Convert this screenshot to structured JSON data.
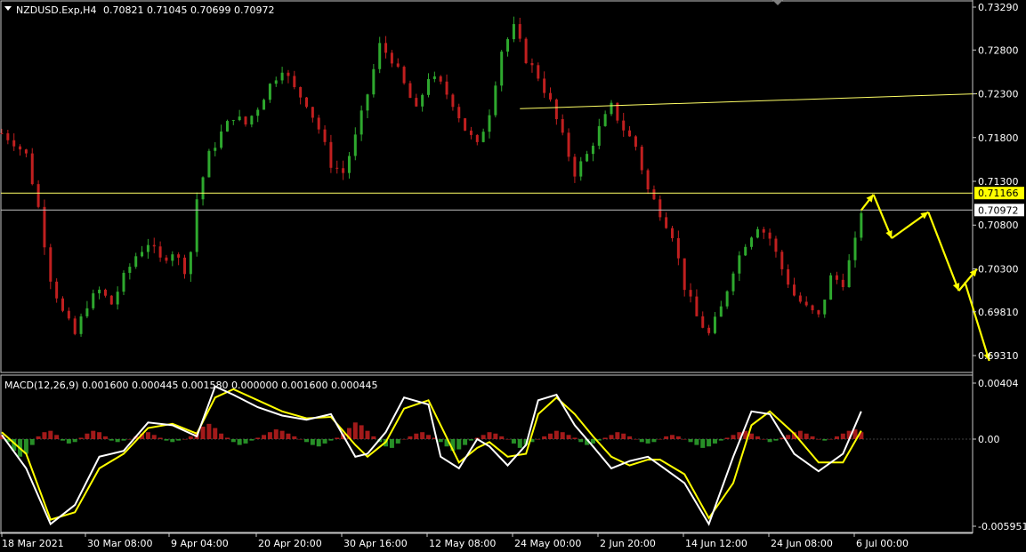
{
  "header": {
    "symbol_label": "NZDUSD.Exp,H4",
    "ohlc_label": "0.70821 0.71045 0.70699 0.70972"
  },
  "macd": {
    "label": "MACD(12,26,9) 0.001600 0.000445 0.001580 0.000000 0.001600 0.000445"
  },
  "colors": {
    "background": "#000000",
    "bull": "#2ea82e",
    "bear": "#c01f1f",
    "signal": "#ffff00",
    "macd_line": "#ffffff",
    "level": "#ffff66",
    "price_marker": "#c0c0c0"
  },
  "chart_data": [
    {
      "type": "candlestick",
      "symbol": "NZDUSD.Exp",
      "timeframe": "H4",
      "y_ticks": [
        "0.73290",
        "0.72800",
        "0.72300",
        "0.71800",
        "0.71300",
        "0.70800",
        "0.70300",
        "0.69810",
        "0.69310"
      ],
      "ylim": [
        0.692,
        0.734
      ],
      "x_ticks": [
        "18 Mar 2021",
        "30 Mar 08:00",
        "9 Apr 04:00",
        "20 Apr 20:00",
        "30 Apr 16:00",
        "12 May 08:00",
        "24 May 00:00",
        "2 Jun 20:00",
        "14 Jun 12:00",
        "24 Jun 08:00",
        "6 Jul 00:00"
      ],
      "close_path": [
        [
          0,
          0.7185
        ],
        [
          2,
          0.7175
        ],
        [
          4,
          0.716
        ],
        [
          6,
          0.71
        ],
        [
          8,
          0.702
        ],
        [
          10,
          0.698
        ],
        [
          12,
          0.6955
        ],
        [
          14,
          0.699
        ],
        [
          16,
          0.7005
        ],
        [
          18,
          0.699
        ],
        [
          20,
          0.702
        ],
        [
          22,
          0.7045
        ],
        [
          24,
          0.706
        ],
        [
          26,
          0.704
        ],
        [
          28,
          0.705
        ],
        [
          30,
          0.703
        ],
        [
          31,
          0.705
        ],
        [
          32,
          0.711
        ],
        [
          34,
          0.716
        ],
        [
          36,
          0.7185
        ],
        [
          38,
          0.7205
        ],
        [
          40,
          0.7195
        ],
        [
          42,
          0.7215
        ],
        [
          44,
          0.724
        ],
        [
          46,
          0.726
        ],
        [
          48,
          0.7235
        ],
        [
          50,
          0.722
        ],
        [
          52,
          0.719
        ],
        [
          54,
          0.715
        ],
        [
          56,
          0.714
        ],
        [
          58,
          0.718
        ],
        [
          60,
          0.723
        ],
        [
          62,
          0.7285
        ],
        [
          64,
          0.727
        ],
        [
          66,
          0.724
        ],
        [
          68,
          0.721
        ],
        [
          70,
          0.725
        ],
        [
          72,
          0.724
        ],
        [
          74,
          0.722
        ],
        [
          76,
          0.719
        ],
        [
          78,
          0.717
        ],
        [
          80,
          0.721
        ],
        [
          82,
          0.728
        ],
        [
          84,
          0.7305
        ],
        [
          86,
          0.727
        ],
        [
          88,
          0.725
        ],
        [
          90,
          0.722
        ],
        [
          92,
          0.718
        ],
        [
          94,
          0.714
        ],
        [
          96,
          0.716
        ],
        [
          98,
          0.719
        ],
        [
          100,
          0.7215
        ],
        [
          102,
          0.719
        ],
        [
          104,
          0.717
        ],
        [
          106,
          0.712
        ],
        [
          108,
          0.7095
        ],
        [
          110,
          0.707
        ],
        [
          112,
          0.701
        ],
        [
          114,
          0.6975
        ],
        [
          116,
          0.6955
        ],
        [
          118,
          0.6985
        ],
        [
          120,
          0.703
        ],
        [
          122,
          0.706
        ],
        [
          124,
          0.708
        ],
        [
          126,
          0.7065
        ],
        [
          128,
          0.703
        ],
        [
          130,
          0.7
        ],
        [
          132,
          0.6985
        ],
        [
          134,
          0.6975
        ],
        [
          136,
          0.702
        ],
        [
          138,
          0.7015
        ],
        [
          140,
          0.706
        ],
        [
          141,
          0.7097
        ]
      ],
      "levels": [
        {
          "value": 0.71166,
          "label": "0.71166",
          "kind": "horizontal"
        },
        {
          "value": 0.70972,
          "label": "0.70972",
          "kind": "current-price"
        }
      ],
      "trendline": {
        "from": [
          85,
          0.7213
        ],
        "to": [
          160,
          0.723
        ]
      },
      "forecast_path": [
        [
          141,
          0.7097
        ],
        [
          143,
          0.7115
        ],
        [
          146,
          0.7065
        ],
        [
          152,
          0.7095
        ],
        [
          157,
          0.7005
        ],
        [
          160,
          0.703
        ]
      ],
      "forecast_tail": [
        [
          158,
          0.7015
        ],
        [
          162,
          0.6925
        ]
      ]
    },
    {
      "type": "macd",
      "params": "12,26,9",
      "y_ticks": [
        "0.00404",
        "0.00",
        "-0.005951"
      ],
      "ylim": [
        -0.0062,
        0.0042
      ],
      "histogram": [
        0.0003,
        -0.0002,
        -0.0008,
        -0.0012,
        -0.001,
        -0.0004,
        0.0002,
        0.0005,
        0.0006,
        0.0003,
        -0.0001,
        -0.0003,
        -0.0002,
        0.0001,
        0.0004,
        0.0006,
        0.0005,
        0.0002,
        -0.0001,
        -0.0002,
        -0.0001,
        0.0,
        0.0002,
        0.0004,
        0.0005,
        0.0003,
        0.0001,
        -0.0001,
        -0.0002,
        -0.0001,
        0.0,
        0.0002,
        0.0005,
        0.0009,
        0.0011,
        0.0008,
        0.0004,
        0.0001,
        -0.0002,
        -0.0004,
        -0.0003,
        -0.0001,
        0.0001,
        0.0003,
        0.0005,
        0.0007,
        0.0006,
        0.0004,
        0.0002,
        0.0,
        -0.0002,
        -0.0004,
        -0.0005,
        -0.0003,
        -0.0001,
        0.0001,
        0.0004,
        0.0008,
        0.0012,
        0.001,
        0.0006,
        0.0002,
        -0.0002,
        -0.0005,
        -0.0006,
        -0.0003,
        0.0,
        0.0002,
        0.0004,
        0.0005,
        0.0003,
        0.0001,
        -0.0002,
        -0.0005,
        -0.0008,
        -0.0007,
        -0.0004,
        -0.0001,
        0.0001,
        0.0003,
        0.0005,
        0.0004,
        0.0002,
        0.0,
        -0.0003,
        -0.0006,
        -0.0004,
        -0.0002,
        0.0,
        0.0002,
        0.0004,
        0.0006,
        0.0005,
        0.0003,
        0.0001,
        -0.0002,
        -0.0004,
        -0.0003,
        -0.0001,
        0.0001,
        0.0003,
        0.0005,
        0.0004,
        0.0002,
        0.0,
        -0.0002,
        -0.0003,
        -0.0002,
        0.0,
        0.0002,
        0.0003,
        0.0002,
        0.0,
        -0.0002,
        -0.0004,
        -0.0006,
        -0.0005,
        -0.0003,
        -0.0001,
        0.0001,
        0.0003,
        0.0005,
        0.0006,
        0.0004,
        0.0002,
        0.0,
        -0.0002,
        -0.0001,
        0.0001,
        0.0003,
        0.0005,
        0.0006,
        0.0004,
        0.0002,
        0.0,
        -0.0001,
        0.0,
        0.0002,
        0.0004,
        0.0006,
        0.0007,
        0.0005
      ],
      "main_path": [
        [
          0,
          0.0003
        ],
        [
          4,
          -0.002
        ],
        [
          8,
          -0.0058
        ],
        [
          12,
          -0.0045
        ],
        [
          16,
          -0.0012
        ],
        [
          20,
          -0.0008
        ],
        [
          24,
          0.0012
        ],
        [
          28,
          0.001
        ],
        [
          32,
          0.0002
        ],
        [
          35,
          0.0038
        ],
        [
          38,
          0.0032
        ],
        [
          42,
          0.0023
        ],
        [
          46,
          0.0017
        ],
        [
          50,
          0.0014
        ],
        [
          54,
          0.0018
        ],
        [
          58,
          -0.0012
        ],
        [
          60,
          -0.001
        ],
        [
          63,
          0.0005
        ],
        [
          66,
          0.003
        ],
        [
          70,
          0.0025
        ],
        [
          72,
          -0.0012
        ],
        [
          75,
          -0.002
        ],
        [
          78,
          0.0
        ],
        [
          80,
          -0.0005
        ],
        [
          83,
          -0.0018
        ],
        [
          86,
          -0.0004
        ],
        [
          88,
          0.0028
        ],
        [
          91,
          0.0032
        ],
        [
          94,
          0.001
        ],
        [
          97,
          -0.0005
        ],
        [
          100,
          -0.002
        ],
        [
          103,
          -0.0015
        ],
        [
          106,
          -0.0012
        ],
        [
          108,
          -0.0018
        ],
        [
          112,
          -0.003
        ],
        [
          116,
          -0.0058
        ],
        [
          120,
          -0.0012
        ],
        [
          123,
          0.002
        ],
        [
          126,
          0.0018
        ],
        [
          130,
          -0.001
        ],
        [
          134,
          -0.0022
        ],
        [
          138,
          -0.001
        ],
        [
          141,
          0.002
        ]
      ],
      "signal_path": [
        [
          0,
          0.0005
        ],
        [
          4,
          -0.001
        ],
        [
          8,
          -0.0055
        ],
        [
          12,
          -0.005
        ],
        [
          16,
          -0.002
        ],
        [
          20,
          -0.001
        ],
        [
          24,
          0.0008
        ],
        [
          28,
          0.0011
        ],
        [
          32,
          0.0004
        ],
        [
          35,
          0.003
        ],
        [
          38,
          0.0036
        ],
        [
          42,
          0.0028
        ],
        [
          46,
          0.002
        ],
        [
          50,
          0.0015
        ],
        [
          54,
          0.0016
        ],
        [
          58,
          -0.0004
        ],
        [
          60,
          -0.0012
        ],
        [
          63,
          -0.0002
        ],
        [
          66,
          0.0022
        ],
        [
          70,
          0.0028
        ],
        [
          72,
          0.001
        ],
        [
          75,
          -0.0016
        ],
        [
          78,
          -0.0006
        ],
        [
          80,
          -0.0002
        ],
        [
          83,
          -0.0012
        ],
        [
          86,
          -0.001
        ],
        [
          88,
          0.0018
        ],
        [
          91,
          0.003
        ],
        [
          94,
          0.0018
        ],
        [
          97,
          0.0002
        ],
        [
          100,
          -0.0012
        ],
        [
          103,
          -0.0018
        ],
        [
          106,
          -0.0014
        ],
        [
          108,
          -0.0014
        ],
        [
          112,
          -0.0024
        ],
        [
          116,
          -0.0054
        ],
        [
          120,
          -0.003
        ],
        [
          123,
          0.001
        ],
        [
          126,
          0.002
        ],
        [
          130,
          0.0004
        ],
        [
          134,
          -0.0016
        ],
        [
          138,
          -0.0016
        ],
        [
          141,
          0.0006
        ]
      ]
    }
  ]
}
